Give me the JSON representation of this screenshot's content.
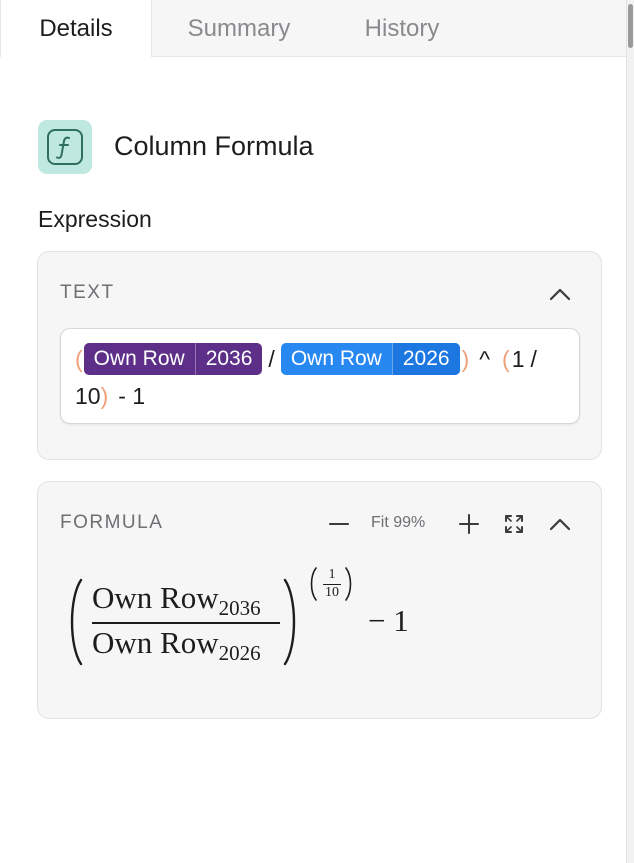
{
  "tabs": [
    {
      "label": "Details",
      "active": true
    },
    {
      "label": "Summary",
      "active": false
    },
    {
      "label": "History",
      "active": false
    }
  ],
  "column": {
    "icon": "function-icon",
    "title": "Column Formula"
  },
  "expression_label": "Expression",
  "text_card": {
    "header": "TEXT",
    "line1": {
      "open_paren": "(",
      "ref1": {
        "name": "Own Row",
        "value": "2036",
        "color": "#5d2f88"
      },
      "slash": "/",
      "ref2": {
        "name": "Own Row",
        "value": "2026",
        "color": "#2788f2"
      },
      "close_paren": ")",
      "caret": "^",
      "open_paren2": "(",
      "one": "1",
      "slash2": "/"
    },
    "line2": {
      "ten": "10",
      "close_paren2": ")",
      "minus_one": "- 1"
    }
  },
  "formula_card": {
    "header": "FORMULA",
    "zoom_label": "Fit 99%",
    "math": {
      "numerator": "Own Row",
      "numerator_sub": "2036",
      "denominator": "Own Row",
      "denominator_sub": "2026",
      "exp_num": "1",
      "exp_den": "10",
      "minus": "−",
      "one": "1"
    }
  },
  "colors": {
    "paren": "#f0a07a",
    "icon_bg": "#bfe8e0",
    "icon_stroke": "#2f6e63"
  }
}
